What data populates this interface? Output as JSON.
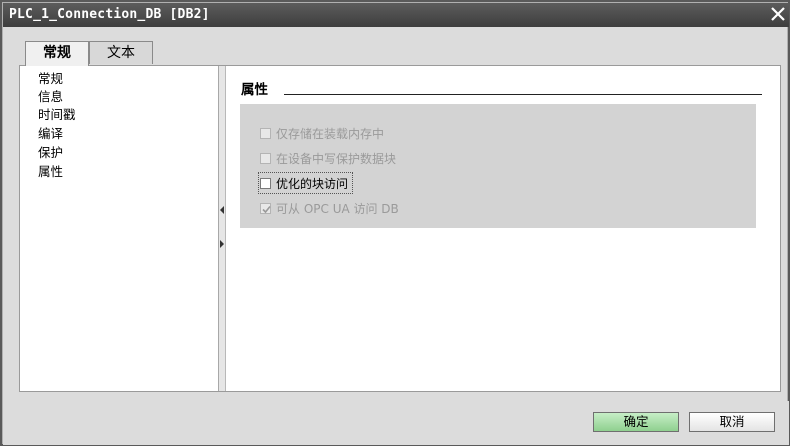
{
  "window": {
    "title": "PLC_1_Connection_DB [DB2]"
  },
  "tabs": [
    {
      "label": "常规",
      "active": true
    },
    {
      "label": "文本",
      "active": false
    }
  ],
  "nav": {
    "items": [
      {
        "label": "常规"
      },
      {
        "label": "信息"
      },
      {
        "label": "时间戳"
      },
      {
        "label": "编译"
      },
      {
        "label": "保护"
      },
      {
        "label": "属性",
        "selected": true
      }
    ]
  },
  "content": {
    "section_title": "属性",
    "options": [
      {
        "label": "仅存储在装载内存中",
        "checked": false,
        "enabled": false
      },
      {
        "label": "在设备中写保护数据块",
        "checked": false,
        "enabled": false
      },
      {
        "label": "优化的块访问",
        "checked": false,
        "enabled": true,
        "focused": true
      },
      {
        "label": "可从 OPC UA 访问 DB",
        "checked": true,
        "enabled": false
      }
    ]
  },
  "footer": {
    "ok_label": "确定",
    "cancel_label": "取消"
  },
  "colors": {
    "titlebar": "#4a4a4a",
    "ok_button": "#a8dfa8",
    "group_background": "#d3d3d3"
  },
  "icons": {
    "close": "close-icon",
    "splitter_left": "arrow-left-icon",
    "splitter_right": "arrow-right-icon",
    "check": "checkmark-icon"
  }
}
